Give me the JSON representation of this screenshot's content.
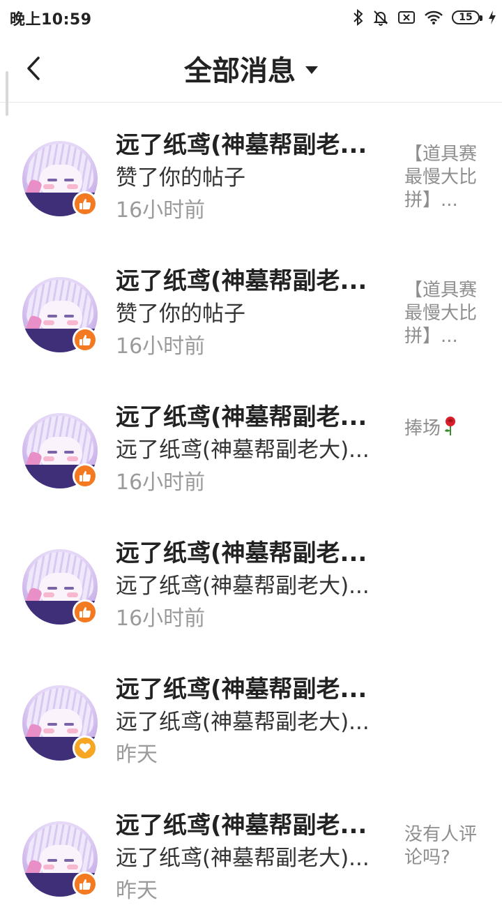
{
  "status_bar": {
    "time": "晚上10:59",
    "battery": "15",
    "icons": [
      "bluetooth-icon",
      "mute-bell-icon",
      "sim-off-icon",
      "wifi-icon",
      "battery-icon",
      "charging-bolt-icon"
    ]
  },
  "header": {
    "back_icon": "chevron-left-icon",
    "title": "全部消息",
    "dropdown_icon": "caret-down-icon"
  },
  "messages": [
    {
      "name": "远了纸鸢(神墓帮副老...",
      "action": "赞了你的帖子",
      "time": "16小时前",
      "preview": "【道具赛最慢大比拼】...",
      "badge": "thumbs-up-icon",
      "badge_color": "#f47a21"
    },
    {
      "name": "远了纸鸢(神墓帮副老...",
      "action": "赞了你的帖子",
      "time": "16小时前",
      "preview": "【道具赛最慢大比拼】...",
      "badge": "thumbs-up-icon",
      "badge_color": "#f47a21"
    },
    {
      "name": "远了纸鸢(神墓帮副老...",
      "action": "远了纸鸢(神墓帮副老大)...",
      "time": "16小时前",
      "preview": "捧场",
      "preview_icon": "rose-icon",
      "badge": "thumbs-up-icon",
      "badge_color": "#f47a21"
    },
    {
      "name": "远了纸鸢(神墓帮副老...",
      "action": "远了纸鸢(神墓帮副老大)...",
      "time": "16小时前",
      "preview": "",
      "badge": "thumbs-up-icon",
      "badge_color": "#f47a21"
    },
    {
      "name": "远了纸鸢(神墓帮副老...",
      "action": "远了纸鸢(神墓帮副老大)...",
      "time": "昨天",
      "preview": "",
      "badge": "heart-icon",
      "badge_color": "#f6a623"
    },
    {
      "name": "远了纸鸢(神墓帮副老...",
      "action": "远了纸鸢(神墓帮副老大)...",
      "time": "昨天",
      "preview": "没有人评论吗?",
      "badge": "thumbs-up-icon",
      "badge_color": "#f47a21"
    }
  ]
}
